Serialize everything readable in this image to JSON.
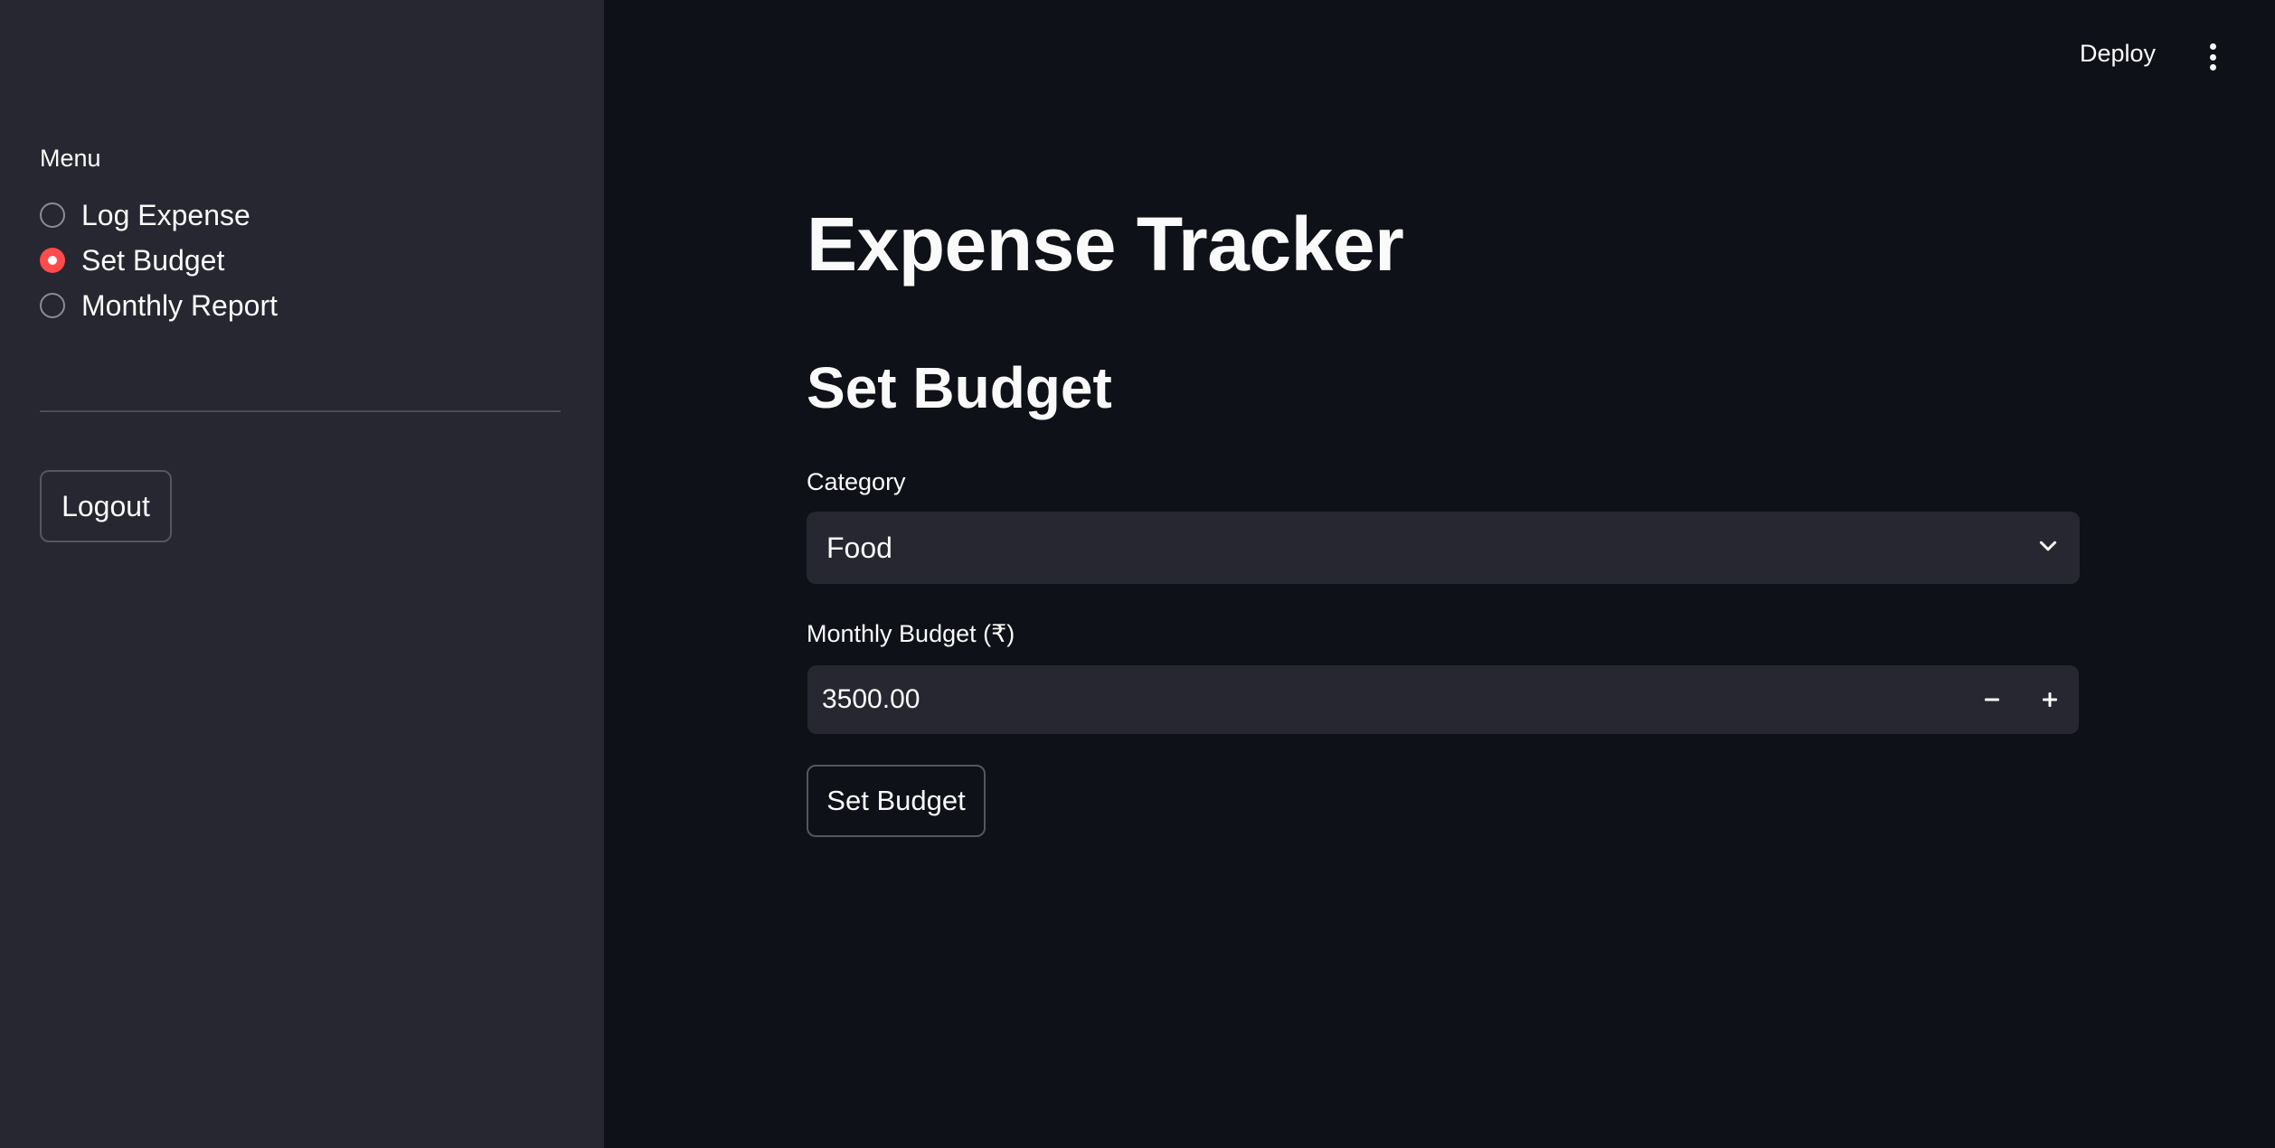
{
  "header": {
    "deploy_label": "Deploy",
    "menu_icon": "kebab-menu-icon"
  },
  "sidebar": {
    "menu_label": "Menu",
    "options": [
      {
        "label": "Log Expense",
        "selected": false
      },
      {
        "label": "Set Budget",
        "selected": true
      },
      {
        "label": "Monthly Report",
        "selected": false
      }
    ],
    "logout_label": "Logout"
  },
  "main": {
    "title": "Expense Tracker",
    "subtitle": "Set Budget",
    "category": {
      "label": "Category",
      "value": "Food",
      "icon": "chevron-down-icon"
    },
    "budget": {
      "label": "Monthly Budget (₹)",
      "value": "3500.00",
      "decrement_icon": "minus-icon",
      "increment_icon": "plus-icon"
    },
    "submit_label": "Set Budget"
  },
  "colors": {
    "background": "#0e1117",
    "sidebar": "#262730",
    "accent": "#ff4b4b",
    "text": "#fafafa"
  }
}
